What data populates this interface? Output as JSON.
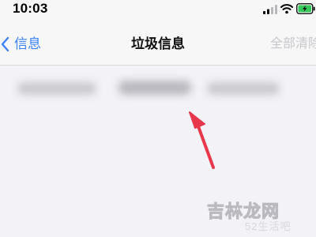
{
  "status_bar": {
    "time": "10:03",
    "icons": [
      "cellular-signal-icon",
      "wifi-icon",
      "battery-charging-icon"
    ]
  },
  "nav": {
    "back_label": "信息",
    "title": "垃圾信息",
    "clear_all_label": "全部清除"
  },
  "watermark": {
    "main": "吉林龙网",
    "sub": "52生活吧"
  },
  "colors": {
    "accent": "#3a82f7",
    "disabled": "#c7c7cc",
    "arrow": "#e8374a",
    "background": "#f2f2f7",
    "battery": "#34c759"
  }
}
